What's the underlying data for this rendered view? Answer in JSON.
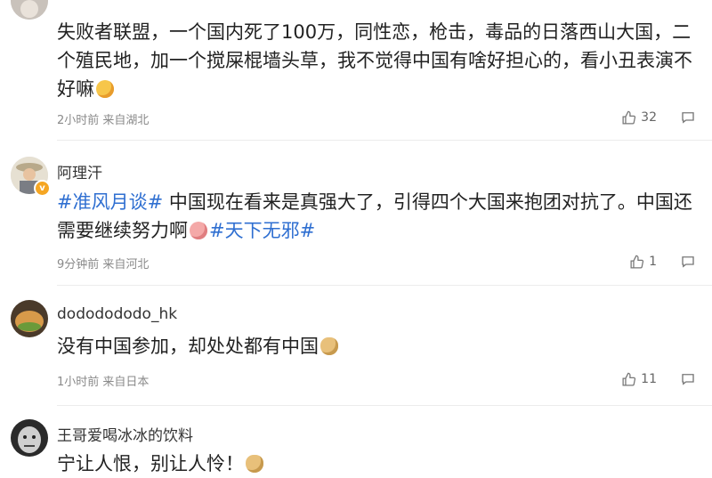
{
  "comments": [
    {
      "username": "",
      "content_parts": [
        "失败者联盟，一个国内死了100万，同性恋，枪击，毒品的日落西山大国，二个殖民地，加一个搅屎棍墙头草，我不觉得中国有啥好担心的，看小丑表演不好嘛"
      ],
      "emoji": "yum-emoji",
      "time": "2小时前 来自湖北",
      "likes": "32"
    },
    {
      "username": "阿理汗",
      "verified": true,
      "hashtag1": "#准风月谈#",
      "content_text": " 中国现在看来是真强大了，引得四个大国来抱团对抗了。中国还需要继续努力啊",
      "hashtag2": "#天下无邪#",
      "emoji": "pig-emoji",
      "time": "9分钟前 来自河北",
      "likes": "1"
    },
    {
      "username": "dododododo_hk",
      "content_text": "没有中国参加，却处处都有中国",
      "emoji": "doge-emoji",
      "time": "1小时前 来自日本",
      "likes": "11"
    },
    {
      "username": "王哥爱喝冰冰的饮料",
      "content_text": "宁让人恨，别让人怜！",
      "emoji": "doge-emoji"
    }
  ],
  "icons": {
    "like": "thumbs-up-icon",
    "reply": "comment-bubble-icon"
  },
  "colors": {
    "hashtag": "#2f6fd1",
    "meta": "#8a8a8a",
    "verified_badge": "#f5a623"
  }
}
